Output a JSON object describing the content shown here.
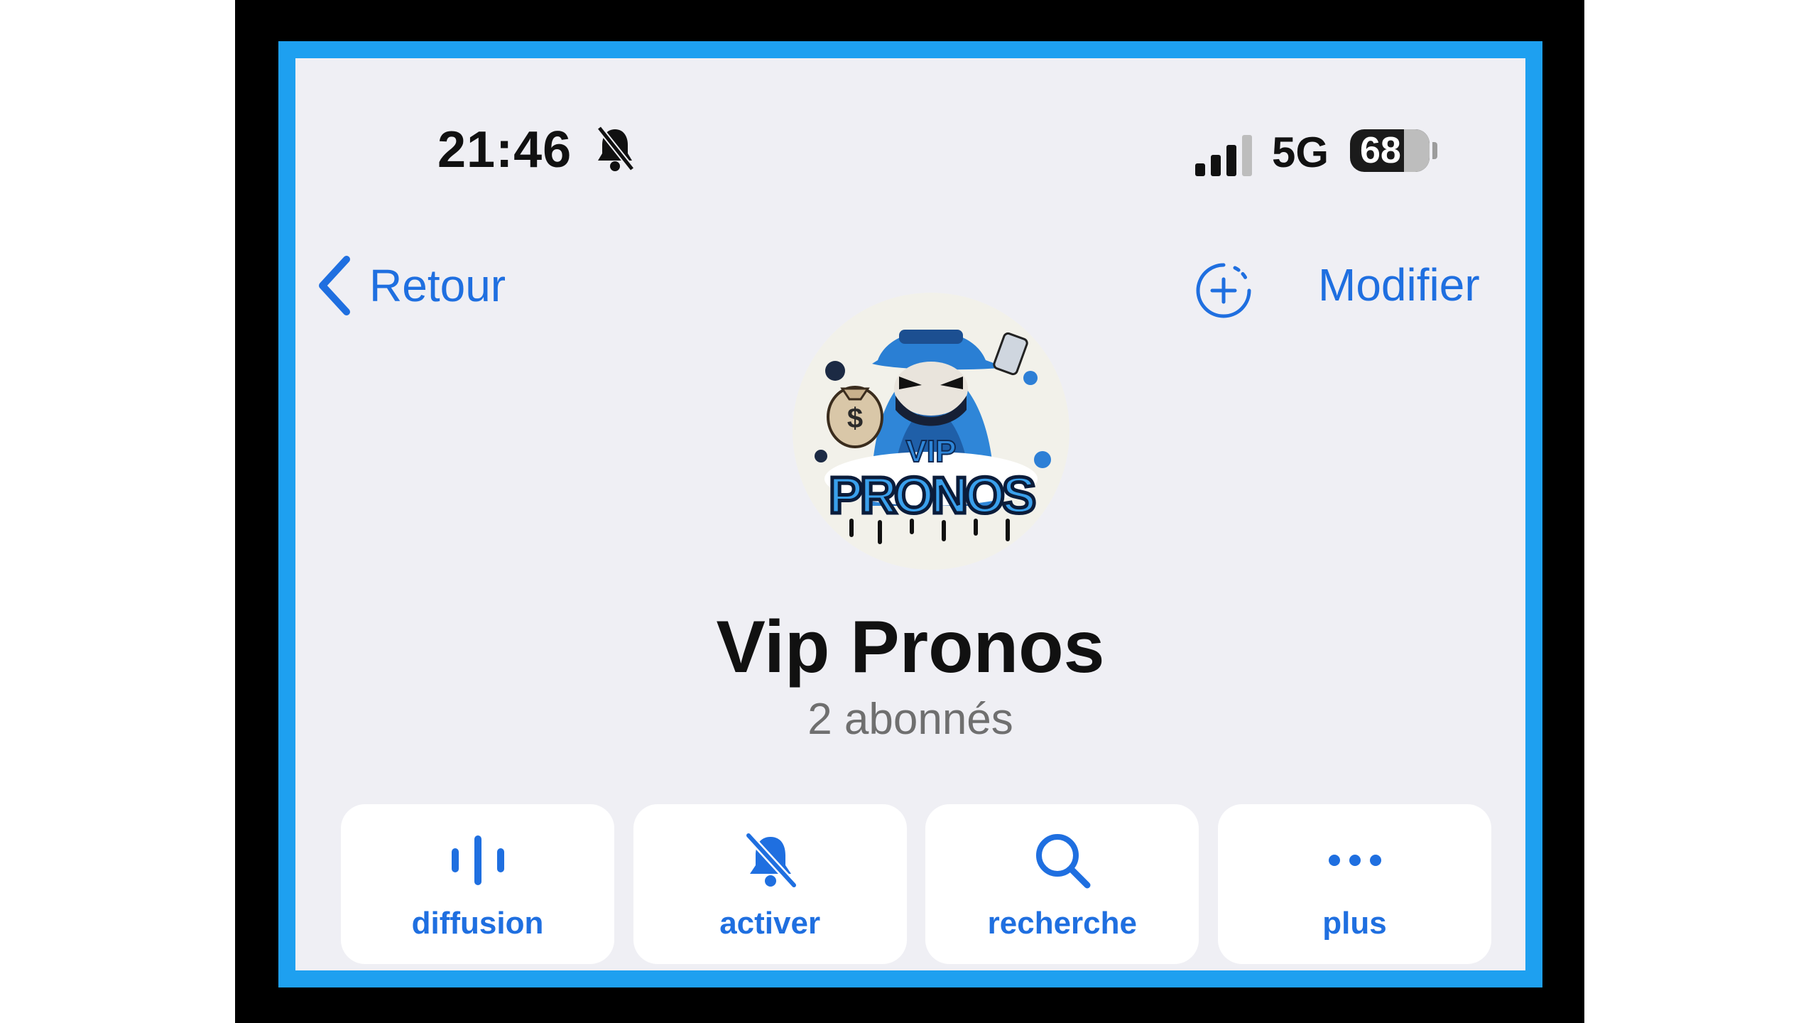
{
  "status_bar": {
    "time": "21:46",
    "mute_icon": "bell-slash-icon",
    "signal_icon": "cellular-signal-icon",
    "network": "5G",
    "battery_level": "68",
    "battery_fraction": 0.68
  },
  "nav": {
    "back_label": "Retour",
    "add_photo_icon": "add-photo-icon",
    "edit_label": "Modifier"
  },
  "channel": {
    "avatar_text": "VIP PRONOS",
    "title": "Vip Pronos",
    "subscribers": "2 abonnés"
  },
  "actions": [
    {
      "label": "diffusion",
      "icon": "broadcast-icon"
    },
    {
      "label": "activer",
      "icon": "bell-slash-icon"
    },
    {
      "label": "recherche",
      "icon": "search-icon"
    },
    {
      "label": "plus",
      "icon": "more-icon"
    }
  ],
  "colors": {
    "accent": "#1f6fe0",
    "frame_border": "#1ea0f0",
    "background": "#efeff4"
  }
}
